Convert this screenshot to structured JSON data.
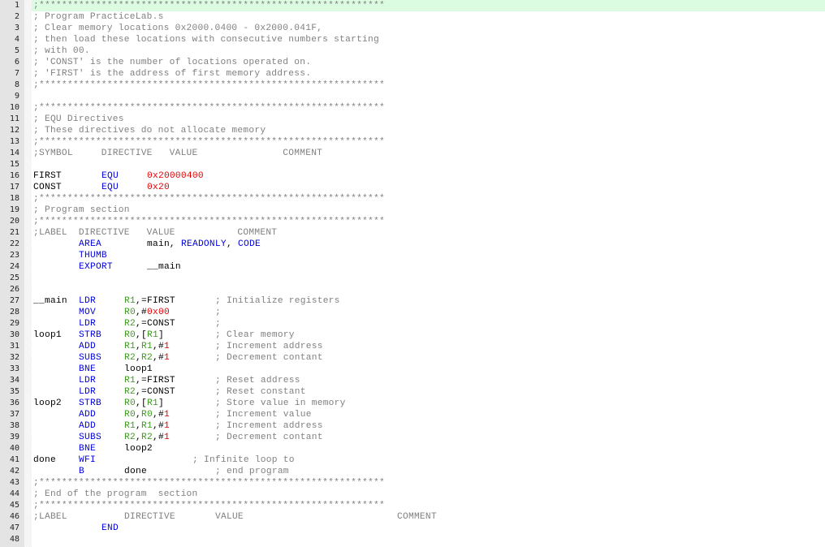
{
  "editor": {
    "current_line": 1,
    "colors": {
      "comment": "#808080",
      "keyword": "#0000e0",
      "number": "#e00000",
      "register": "#3c9b1e",
      "current_line_bg": "#dcfce2",
      "gutter_bg": "#e4e4e4"
    },
    "lines": [
      {
        "n": "1",
        "t": [
          {
            "col": 0,
            "k": "c",
            "s": ";*************************************************************"
          }
        ]
      },
      {
        "n": "2",
        "t": [
          {
            "col": 0,
            "k": "c",
            "s": "; Program PracticeLab.s"
          }
        ]
      },
      {
        "n": "3",
        "t": [
          {
            "col": 0,
            "k": "c",
            "s": "; Clear memory locations 0x2000.0400 - 0x2000.041F,"
          }
        ]
      },
      {
        "n": "4",
        "t": [
          {
            "col": 0,
            "k": "c",
            "s": "; then load these locations with consecutive numbers starting"
          }
        ]
      },
      {
        "n": "5",
        "t": [
          {
            "col": 0,
            "k": "c",
            "s": "; with 00."
          }
        ]
      },
      {
        "n": "6",
        "t": [
          {
            "col": 0,
            "k": "c",
            "s": "; 'CONST' is the number of locations operated on."
          }
        ]
      },
      {
        "n": "7",
        "t": [
          {
            "col": 0,
            "k": "c",
            "s": "; 'FIRST' is the address of first memory address."
          }
        ]
      },
      {
        "n": "8",
        "t": [
          {
            "col": 0,
            "k": "c",
            "s": ";*************************************************************"
          }
        ]
      },
      {
        "n": "9",
        "t": []
      },
      {
        "n": "10",
        "t": [
          {
            "col": 0,
            "k": "c",
            "s": ";*************************************************************"
          }
        ]
      },
      {
        "n": "11",
        "t": [
          {
            "col": 0,
            "k": "c",
            "s": "; EQU Directives"
          }
        ]
      },
      {
        "n": "12",
        "t": [
          {
            "col": 0,
            "k": "c",
            "s": "; These directives do not allocate memory"
          }
        ]
      },
      {
        "n": "13",
        "t": [
          {
            "col": 0,
            "k": "c",
            "s": ";*************************************************************"
          }
        ]
      },
      {
        "n": "14",
        "t": [
          {
            "col": 0,
            "k": "c",
            "s": ";SYMBOL     DIRECTIVE   VALUE               COMMENT"
          }
        ]
      },
      {
        "n": "15",
        "t": []
      },
      {
        "n": "16",
        "t": [
          {
            "col": 0,
            "k": "id",
            "s": "FIRST"
          },
          {
            "col": 12,
            "k": "kw",
            "s": "EQU"
          },
          {
            "col": 20,
            "k": "num",
            "s": "0x20000400"
          }
        ]
      },
      {
        "n": "17",
        "t": [
          {
            "col": 0,
            "k": "id",
            "s": "CONST"
          },
          {
            "col": 12,
            "k": "kw",
            "s": "EQU"
          },
          {
            "col": 20,
            "k": "num",
            "s": "0x20"
          }
        ]
      },
      {
        "n": "18",
        "t": [
          {
            "col": 0,
            "k": "c",
            "s": ";*************************************************************"
          }
        ]
      },
      {
        "n": "19",
        "t": [
          {
            "col": 0,
            "k": "c",
            "s": "; Program section"
          }
        ]
      },
      {
        "n": "20",
        "t": [
          {
            "col": 0,
            "k": "c",
            "s": ";*************************************************************"
          }
        ]
      },
      {
        "n": "21",
        "t": [
          {
            "col": 0,
            "k": "c",
            "s": ";LABEL  DIRECTIVE   VALUE           COMMENT"
          }
        ]
      },
      {
        "n": "22",
        "t": [
          {
            "col": 8,
            "k": "kw",
            "s": "AREA"
          },
          {
            "col": 20,
            "k": "id",
            "s": "main, "
          },
          {
            "col": 26,
            "k": "kw",
            "s": "READONLY"
          },
          {
            "col": 34,
            "k": "id",
            "s": ", "
          },
          {
            "col": 36,
            "k": "kw",
            "s": "CODE"
          }
        ]
      },
      {
        "n": "23",
        "t": [
          {
            "col": 8,
            "k": "kw",
            "s": "THUMB"
          }
        ]
      },
      {
        "n": "24",
        "t": [
          {
            "col": 8,
            "k": "kw",
            "s": "EXPORT"
          },
          {
            "col": 20,
            "k": "id",
            "s": "__main"
          }
        ]
      },
      {
        "n": "25",
        "t": []
      },
      {
        "n": "26",
        "t": []
      },
      {
        "n": "27",
        "t": [
          {
            "col": 0,
            "k": "id",
            "s": "__main"
          },
          {
            "col": 8,
            "k": "kw",
            "s": "LDR"
          },
          {
            "col": 16,
            "k": "reg",
            "s": "R1"
          },
          {
            "col": 18,
            "k": "op",
            "s": ",=FIRST"
          },
          {
            "col": 32,
            "k": "c",
            "s": "; Initialize registers"
          }
        ]
      },
      {
        "n": "28",
        "t": [
          {
            "col": 8,
            "k": "kw",
            "s": "MOV"
          },
          {
            "col": 16,
            "k": "reg",
            "s": "R0"
          },
          {
            "col": 18,
            "k": "op",
            "s": ",#"
          },
          {
            "col": 20,
            "k": "num",
            "s": "0x00"
          },
          {
            "col": 32,
            "k": "c",
            "s": ";"
          }
        ]
      },
      {
        "n": "29",
        "t": [
          {
            "col": 8,
            "k": "kw",
            "s": "LDR"
          },
          {
            "col": 16,
            "k": "reg",
            "s": "R2"
          },
          {
            "col": 18,
            "k": "op",
            "s": ",=CONST"
          },
          {
            "col": 32,
            "k": "c",
            "s": ";"
          }
        ]
      },
      {
        "n": "30",
        "t": [
          {
            "col": 0,
            "k": "id",
            "s": "loop1"
          },
          {
            "col": 8,
            "k": "kw",
            "s": "STRB"
          },
          {
            "col": 16,
            "k": "reg",
            "s": "R0"
          },
          {
            "col": 18,
            "k": "op",
            "s": ",["
          },
          {
            "col": 20,
            "k": "reg",
            "s": "R1"
          },
          {
            "col": 22,
            "k": "op",
            "s": "]"
          },
          {
            "col": 32,
            "k": "c",
            "s": "; Clear memory"
          }
        ]
      },
      {
        "n": "31",
        "t": [
          {
            "col": 8,
            "k": "kw",
            "s": "ADD"
          },
          {
            "col": 16,
            "k": "reg",
            "s": "R1"
          },
          {
            "col": 18,
            "k": "op",
            "s": ","
          },
          {
            "col": 19,
            "k": "reg",
            "s": "R1"
          },
          {
            "col": 21,
            "k": "op",
            "s": ",#"
          },
          {
            "col": 23,
            "k": "num",
            "s": "1"
          },
          {
            "col": 32,
            "k": "c",
            "s": "; Increment address"
          }
        ]
      },
      {
        "n": "32",
        "t": [
          {
            "col": 8,
            "k": "kw",
            "s": "SUBS"
          },
          {
            "col": 16,
            "k": "reg",
            "s": "R2"
          },
          {
            "col": 18,
            "k": "op",
            "s": ","
          },
          {
            "col": 19,
            "k": "reg",
            "s": "R2"
          },
          {
            "col": 21,
            "k": "op",
            "s": ",#"
          },
          {
            "col": 23,
            "k": "num",
            "s": "1"
          },
          {
            "col": 32,
            "k": "c",
            "s": "; Decrement contant"
          }
        ]
      },
      {
        "n": "33",
        "t": [
          {
            "col": 8,
            "k": "kw",
            "s": "BNE"
          },
          {
            "col": 16,
            "k": "id",
            "s": "loop1"
          }
        ]
      },
      {
        "n": "34",
        "t": [
          {
            "col": 8,
            "k": "kw",
            "s": "LDR"
          },
          {
            "col": 16,
            "k": "reg",
            "s": "R1"
          },
          {
            "col": 18,
            "k": "op",
            "s": ",=FIRST"
          },
          {
            "col": 32,
            "k": "c",
            "s": "; Reset address"
          }
        ]
      },
      {
        "n": "35",
        "t": [
          {
            "col": 8,
            "k": "kw",
            "s": "LDR"
          },
          {
            "col": 16,
            "k": "reg",
            "s": "R2"
          },
          {
            "col": 18,
            "k": "op",
            "s": ",=CONST"
          },
          {
            "col": 32,
            "k": "c",
            "s": "; Reset constant"
          }
        ]
      },
      {
        "n": "36",
        "t": [
          {
            "col": 0,
            "k": "id",
            "s": "loop2"
          },
          {
            "col": 8,
            "k": "kw",
            "s": "STRB"
          },
          {
            "col": 16,
            "k": "reg",
            "s": "R0"
          },
          {
            "col": 18,
            "k": "op",
            "s": ",["
          },
          {
            "col": 20,
            "k": "reg",
            "s": "R1"
          },
          {
            "col": 22,
            "k": "op",
            "s": "]"
          },
          {
            "col": 32,
            "k": "c",
            "s": "; Store value in memory"
          }
        ]
      },
      {
        "n": "37",
        "t": [
          {
            "col": 8,
            "k": "kw",
            "s": "ADD"
          },
          {
            "col": 16,
            "k": "reg",
            "s": "R0"
          },
          {
            "col": 18,
            "k": "op",
            "s": ","
          },
          {
            "col": 19,
            "k": "reg",
            "s": "R0"
          },
          {
            "col": 21,
            "k": "op",
            "s": ",#"
          },
          {
            "col": 23,
            "k": "num",
            "s": "1"
          },
          {
            "col": 32,
            "k": "c",
            "s": "; Increment value"
          }
        ]
      },
      {
        "n": "38",
        "t": [
          {
            "col": 8,
            "k": "kw",
            "s": "ADD"
          },
          {
            "col": 16,
            "k": "reg",
            "s": "R1"
          },
          {
            "col": 18,
            "k": "op",
            "s": ","
          },
          {
            "col": 19,
            "k": "reg",
            "s": "R1"
          },
          {
            "col": 21,
            "k": "op",
            "s": ",#"
          },
          {
            "col": 23,
            "k": "num",
            "s": "1"
          },
          {
            "col": 32,
            "k": "c",
            "s": "; Increment address"
          }
        ]
      },
      {
        "n": "39",
        "t": [
          {
            "col": 8,
            "k": "kw",
            "s": "SUBS"
          },
          {
            "col": 16,
            "k": "reg",
            "s": "R2"
          },
          {
            "col": 18,
            "k": "op",
            "s": ","
          },
          {
            "col": 19,
            "k": "reg",
            "s": "R2"
          },
          {
            "col": 21,
            "k": "op",
            "s": ",#"
          },
          {
            "col": 23,
            "k": "num",
            "s": "1"
          },
          {
            "col": 32,
            "k": "c",
            "s": "; Decrement contant"
          }
        ]
      },
      {
        "n": "40",
        "t": [
          {
            "col": 8,
            "k": "kw",
            "s": "BNE"
          },
          {
            "col": 16,
            "k": "id",
            "s": "loop2"
          }
        ]
      },
      {
        "n": "41",
        "t": [
          {
            "col": 0,
            "k": "id",
            "s": "done"
          },
          {
            "col": 8,
            "k": "kw",
            "s": "WFI"
          },
          {
            "col": 28,
            "k": "c",
            "s": "; Infinite loop to"
          }
        ]
      },
      {
        "n": "42",
        "t": [
          {
            "col": 8,
            "k": "kw",
            "s": "B"
          },
          {
            "col": 16,
            "k": "id",
            "s": "done"
          },
          {
            "col": 32,
            "k": "c",
            "s": "; end program"
          }
        ]
      },
      {
        "n": "43",
        "t": [
          {
            "col": 0,
            "k": "c",
            "s": ";*************************************************************"
          }
        ]
      },
      {
        "n": "44",
        "t": [
          {
            "col": 0,
            "k": "c",
            "s": "; End of the program  section"
          }
        ]
      },
      {
        "n": "45",
        "t": [
          {
            "col": 0,
            "k": "c",
            "s": ";*************************************************************"
          }
        ]
      },
      {
        "n": "46",
        "t": [
          {
            "col": 0,
            "k": "c",
            "s": ";LABEL"
          },
          {
            "col": 16,
            "k": "c",
            "s": "DIRECTIVE"
          },
          {
            "col": 32,
            "k": "c",
            "s": "VALUE"
          },
          {
            "col": 64,
            "k": "c",
            "s": "COMMENT"
          }
        ]
      },
      {
        "n": "47",
        "t": [
          {
            "col": 12,
            "k": "kw",
            "s": "END"
          }
        ]
      },
      {
        "n": "48",
        "t": []
      }
    ]
  }
}
